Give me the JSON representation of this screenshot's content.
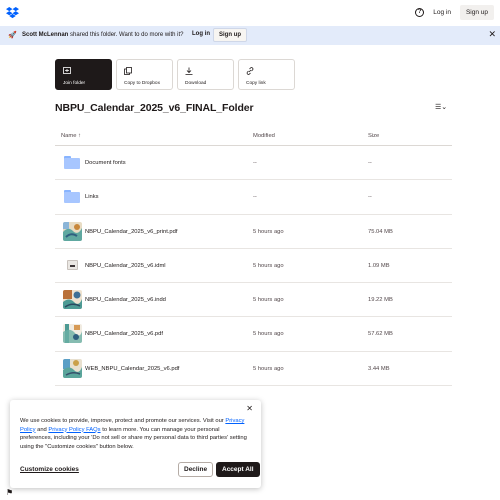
{
  "topbar": {
    "logo_icon": "dropbox-logo-icon",
    "help_icon": "help-icon",
    "login_label": "Log in",
    "signup_label": "Sign up"
  },
  "banner": {
    "icon": "rocket-icon",
    "sender": "Scott McLennan",
    "message": "shared this folder. Want to do more with it?",
    "login_label": "Log in",
    "signup_label": "Sign up",
    "close_icon": "close-icon",
    "bg_color": "#e3ebfa"
  },
  "actions": [
    {
      "label": "Join folder",
      "icon": "join-folder-icon"
    },
    {
      "label": "Copy to Dropbox",
      "icon": "copy-icon"
    },
    {
      "label": "Download",
      "icon": "download-icon"
    },
    {
      "label": "Copy link",
      "icon": "link-icon"
    }
  ],
  "folder": {
    "title": "NBPU_Calendar_2025_v6_FINAL_Folder",
    "view_icon": "list-view-icon"
  },
  "table": {
    "columns": {
      "name": "Name",
      "modified": "Modified",
      "size": "Size"
    },
    "rows": [
      {
        "name": "Document fonts",
        "modified": "--",
        "size": "--",
        "kind": "folder"
      },
      {
        "name": "Links",
        "modified": "--",
        "size": "--",
        "kind": "folder"
      },
      {
        "name": "NBPU_Calendar_2025_v6_print.pdf",
        "modified": "5 hours ago",
        "size": "75.04 MB",
        "kind": "thumb"
      },
      {
        "name": "NBPU_Calendar_2025_v6.idml",
        "modified": "5 hours ago",
        "size": "1.09 MB",
        "kind": "doc"
      },
      {
        "name": "NBPU_Calendar_2025_v6.indd",
        "modified": "5 hours ago",
        "size": "19.22 MB",
        "kind": "thumb"
      },
      {
        "name": "NBPU_Calendar_2025_v6.pdf",
        "modified": "5 hours ago",
        "size": "57.62 MB",
        "kind": "thumb"
      },
      {
        "name": "WEB_NBPU_Calendar_2025_v6.pdf",
        "modified": "5 hours ago",
        "size": "3.44 MB",
        "kind": "thumb"
      }
    ]
  },
  "cookie": {
    "text_1": "We use cookies to provide, improve, protect and promote our services. Visit our",
    "privacy_policy": "Privacy Policy",
    "and": "and",
    "privacy_faqs": "Privacy Policy FAQs",
    "text_2": "to learn more. You can manage your personal preferences, including your 'Do not sell or share my personal data to third parties' setting using the \"Customize cookies\" button below.",
    "customize_label": "Customize cookies",
    "decline_label": "Decline",
    "accept_label": "Accept All",
    "close_icon": "close-icon"
  }
}
